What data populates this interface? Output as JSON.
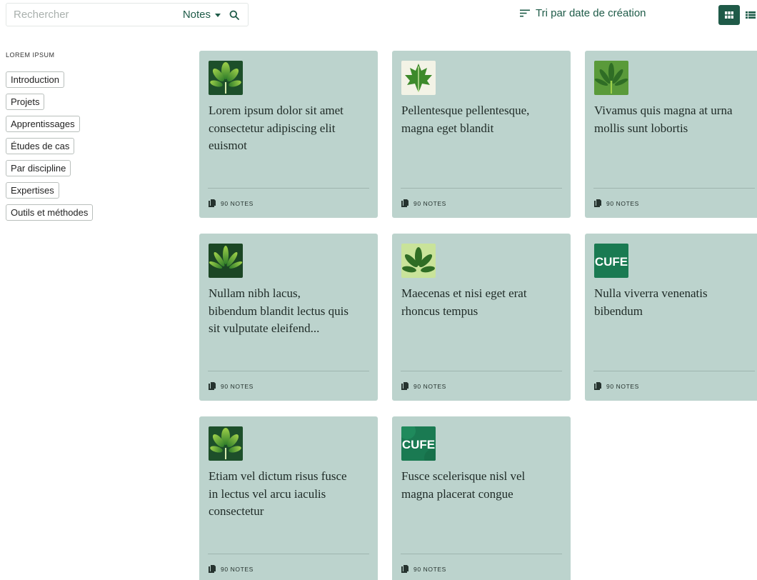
{
  "search": {
    "placeholder": "Rechercher",
    "scope_label": "Notes"
  },
  "sort": {
    "label": "Tri par date de création"
  },
  "view_toggle": {
    "active": "grid"
  },
  "sidebar": {
    "heading": "LOREM IPSUM",
    "items": [
      {
        "label": "Introduction"
      },
      {
        "label": "Projets"
      },
      {
        "label": "Apprentissages"
      },
      {
        "label": "Études de cas"
      },
      {
        "label": "Par discipline"
      },
      {
        "label": "Expertises"
      },
      {
        "label": "Outils et méthodes"
      }
    ]
  },
  "cards": [
    {
      "title": "Lorem ipsum dolor sit amet consectetur adipiscing elit euismot",
      "count": "90 NOTES",
      "icon": "chestnut-leaf-icon"
    },
    {
      "title": "Pellentesque pellentesque, magna eget blandit",
      "count": "90 NOTES",
      "icon": "maple-leaf-icon"
    },
    {
      "title": "Vivamus quis magna at urna mollis sunt lobortis",
      "count": "90 NOTES",
      "icon": "fern-leaf-icon"
    },
    {
      "title": "Nullam nibh lacus, bibendum blandit lectus quis sit vulputate eleifend...",
      "count": "90 NOTES",
      "icon": "fern-leaf-icon"
    },
    {
      "title": "Maecenas et nisi eget erat rhoncus tempus",
      "count": "90 NOTES",
      "icon": "leaf-bunch-icon"
    },
    {
      "title": "Nulla viverra venenatis bibendum",
      "count": "90 NOTES",
      "icon": "cufe-logo",
      "logo_text": "CUFE"
    },
    {
      "title": "Etiam vel dictum risus fusce in lectus vel arcu iaculis consectetur",
      "count": "90 NOTES",
      "icon": "chestnut-leaf-icon"
    },
    {
      "title": "Fusce scelerisque nisl vel magna placerat congue",
      "count": "90 NOTES",
      "icon": "cufe-logo",
      "logo_text": "CUFE"
    }
  ],
  "colors": {
    "accent": "#1f5a48",
    "card_bg": "#bcd3cd",
    "leaf_dark": "#1f5a2a",
    "leaf_light": "#7fbf3f"
  }
}
